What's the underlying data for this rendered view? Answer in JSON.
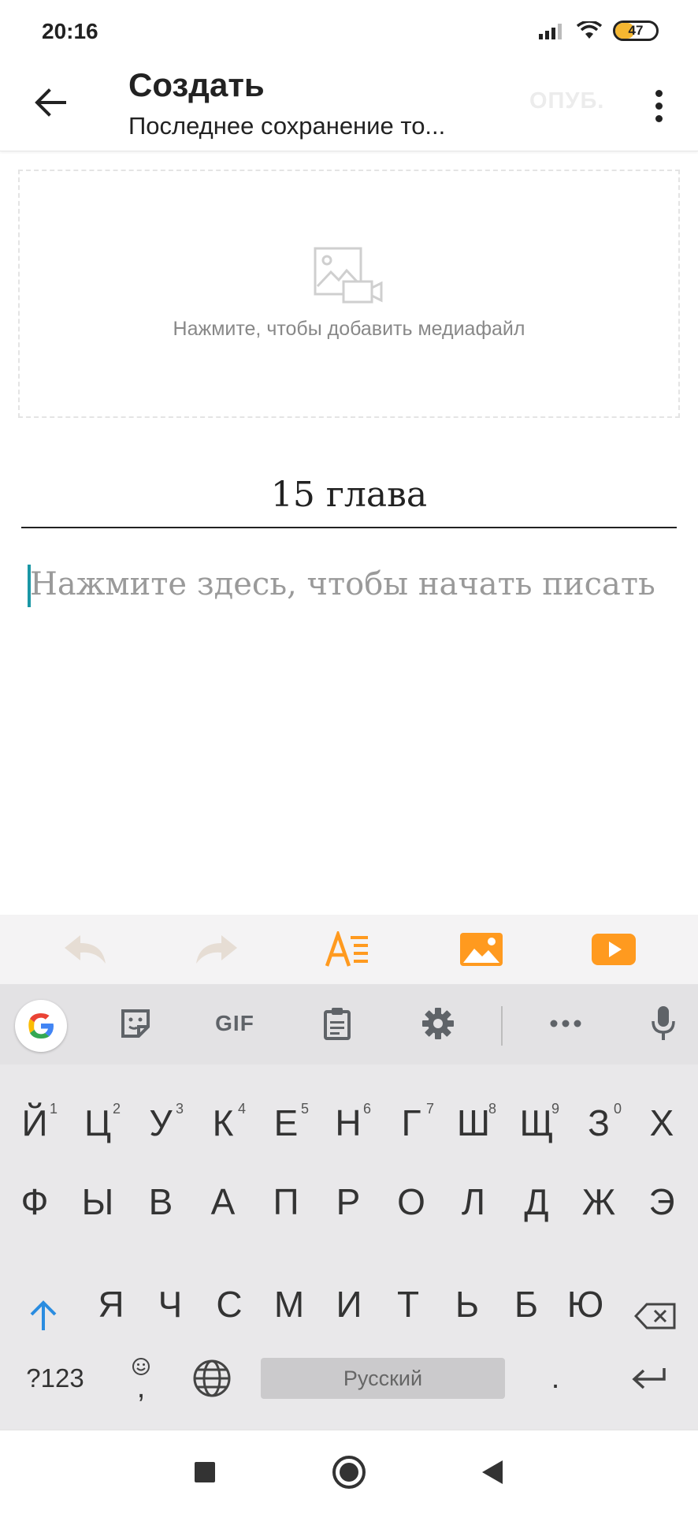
{
  "status_bar": {
    "time": "20:16",
    "battery_level": "47",
    "battery_fraction": 0.47,
    "icons": [
      "signal-icon",
      "wifi-icon",
      "battery-icon"
    ]
  },
  "app_bar": {
    "title": "Создать",
    "subtitle": "Последнее сохранение то...",
    "publish_label": "ОПУБ.",
    "icons": [
      "back-arrow-icon",
      "more-vert-icon"
    ]
  },
  "media": {
    "label": "Нажмите, чтобы добавить медиафайл",
    "icon": "image-video-icon"
  },
  "editor": {
    "title_value": "15 глава",
    "body_placeholder": "Нажмите здесь, чтобы начать писать"
  },
  "editor_toolbar": {
    "items": [
      "undo-icon",
      "redo-icon",
      "text-format-icon",
      "insert-image-icon",
      "insert-video-icon"
    ],
    "accent_color": "#ff9a1f",
    "disabled_color": "#e0d8d0"
  },
  "keyboard": {
    "toolbar": {
      "gif_label": "GIF",
      "icons": [
        "google-g-icon",
        "sticker-icon",
        "gif-icon",
        "clipboard-icon",
        "settings-icon",
        "more-horiz-icon",
        "mic-icon"
      ]
    },
    "row1": [
      "Й",
      "Ц",
      "У",
      "К",
      "Е",
      "Н",
      "Г",
      "Ш",
      "Щ",
      "З",
      "Х"
    ],
    "row1_hints": [
      "1",
      "2",
      "3",
      "4",
      "5",
      "6",
      "7",
      "8",
      "9",
      "0"
    ],
    "row2": [
      "Ф",
      "Ы",
      "В",
      "А",
      "П",
      "Р",
      "О",
      "Л",
      "Д",
      "Ж",
      "Э"
    ],
    "row3": [
      "Я",
      "Ч",
      "С",
      "М",
      "И",
      "Т",
      "Ь",
      "Б",
      "Ю"
    ],
    "symbols_label": "?123",
    "comma_label": ",",
    "space_label": "Русский",
    "period_label": ".",
    "special_icons": [
      "shift-icon",
      "backspace-icon",
      "emoji-icon",
      "globe-icon",
      "enter-icon"
    ]
  },
  "nav_bar": {
    "icons": [
      "recents-square-icon",
      "home-circle-icon",
      "back-triangle-icon"
    ]
  }
}
